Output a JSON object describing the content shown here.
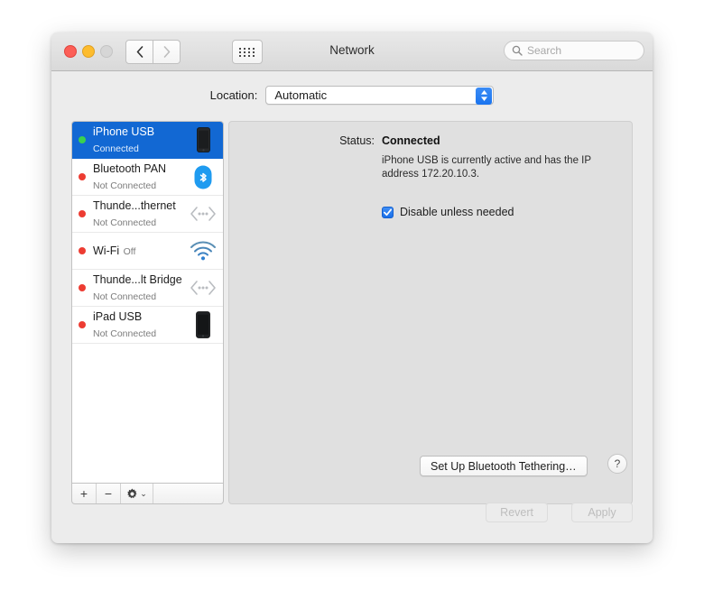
{
  "window": {
    "title": "Network",
    "traffic_lights": [
      "close",
      "minimize",
      "zoom"
    ],
    "nav": {
      "back_icon": "chevron-left",
      "forward_icon": "chevron-right",
      "grid_icon": "grid-dots"
    },
    "search": {
      "placeholder": "Search",
      "icon": "search-icon"
    }
  },
  "location": {
    "label": "Location:",
    "value": "Automatic"
  },
  "services": [
    {
      "name": "iPhone USB",
      "status": "Connected",
      "dot": "green",
      "icon": "iphone-icon",
      "selected": true
    },
    {
      "name": "Bluetooth PAN",
      "status": "Not Connected",
      "dot": "red",
      "icon": "bluetooth-icon",
      "selected": false
    },
    {
      "name": "Thunde...thernet",
      "status": "Not Connected",
      "dot": "red",
      "icon": "thunderbolt-icon",
      "selected": false
    },
    {
      "name": "Wi-Fi",
      "status": "Off",
      "dot": "red",
      "icon": "wifi-icon",
      "selected": false
    },
    {
      "name": "Thunde...lt Bridge",
      "status": "Not Connected",
      "dot": "red",
      "icon": "thunderbolt-icon",
      "selected": false
    },
    {
      "name": "iPad USB",
      "status": "Not Connected",
      "dot": "red",
      "icon": "ipad-icon",
      "selected": false
    }
  ],
  "sidebar_toolbar": {
    "add_label": "+",
    "remove_label": "−",
    "gear_icon": "gear-icon",
    "gear_chevron": "⌄"
  },
  "detail": {
    "status_label": "Status:",
    "status_value": "Connected",
    "status_description": "iPhone USB is currently active and has the IP address 172.20.10.3.",
    "checkbox_label": "Disable unless needed",
    "checkbox_checked": true,
    "tethering_button": "Set Up Bluetooth Tethering…",
    "help_button": "?"
  },
  "footer": {
    "revert_label": "Revert",
    "apply_label": "Apply",
    "revert_enabled": false,
    "apply_enabled": false
  },
  "colors": {
    "selection_blue": "#1268d3",
    "accent_blue": "#1a74ef",
    "status_connected_dot": "#3ad14f",
    "status_disconnected_dot": "#ed3c32",
    "panel_grey": "#e0e0e0",
    "window_chrome": "#ececec"
  }
}
